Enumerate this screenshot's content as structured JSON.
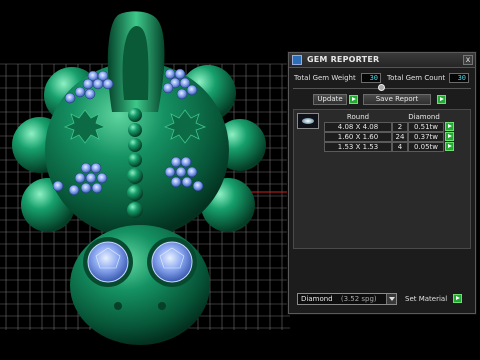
{
  "panel": {
    "title": "GEM REPORTER",
    "close_label": "x",
    "total_gem_weight_label": "Total Gem Weight",
    "total_gem_weight_value": "30",
    "total_gem_count_label": "Total Gem Count",
    "total_gem_count_value": "30",
    "update_label": "Update",
    "save_report_label": "Save Report",
    "table": {
      "headers": [
        "Round",
        "Diamond"
      ],
      "rows": [
        {
          "size": "4.08 X 4.08",
          "count": "2",
          "weight": "0.51tw"
        },
        {
          "size": "1.60 X 1.60",
          "count": "24",
          "weight": "0.37tw"
        },
        {
          "size": "1.53 X 1.53",
          "count": "4",
          "weight": "0.05tw"
        }
      ]
    },
    "material_select": {
      "value": "Diamond",
      "detail": "(3.52 spg)"
    },
    "set_material_label": "Set Material"
  },
  "colors": {
    "model_green": "#0f7a4e",
    "gem_blue": "#8aa8f0",
    "grid_lines": "#7a7a7a",
    "field_text": "#4cd6e8",
    "arrow_green": "#22aa33"
  }
}
